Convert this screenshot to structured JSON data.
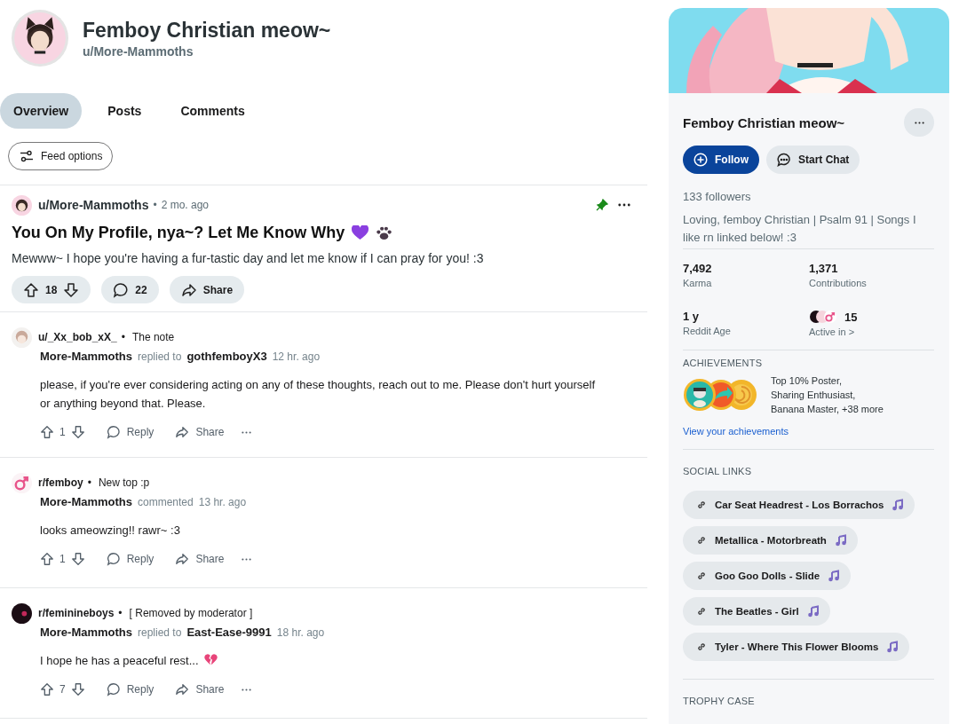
{
  "profile": {
    "display_name": "Femboy Christian meow~",
    "username": "u/More-Mammoths"
  },
  "tabs": [
    {
      "label": "Overview",
      "selected": true
    },
    {
      "label": "Posts",
      "selected": false
    },
    {
      "label": "Comments",
      "selected": false
    }
  ],
  "feed_options": {
    "label": "Feed options"
  },
  "post": {
    "author": "u/More-Mammoths",
    "separator": "•",
    "time": "2 mo. ago",
    "pinned": true,
    "title": "You On My Profile, nya~? Let Me Know Why",
    "title_icons": [
      {
        "kind": "heart"
      },
      {
        "kind": "paw"
      }
    ],
    "body": "Mewww~ I hope you're having a fur-tastic day and let me know if I can pray for you! :3",
    "votes": "18",
    "comments": "22",
    "share": "Share"
  },
  "comments": [
    {
      "source": "u/_Xx_bob_xX_",
      "separator": "•",
      "context": "The note",
      "author": "More-Mammoths",
      "action": "replied to",
      "target": "gothfemboyX3",
      "time": "12 hr. ago",
      "body": "please, if you're ever considering acting on any of these thoughts, reach out to me. Please don't hurt yourself or anything beyond that. Please.",
      "votes": "1",
      "reply": "Reply",
      "share": "Share"
    },
    {
      "avatar": {
        "kind": "male_sign"
      },
      "source": "r/femboy",
      "separator": "•",
      "context": "New top :p",
      "author": "More-Mammoths",
      "action": "commented",
      "time": "13 hr. ago",
      "body": "looks ameowzing!! rawr~ :3",
      "votes": "1",
      "reply": "Reply",
      "share": "Share"
    },
    {
      "avatar": {
        "kind": "dark"
      },
      "source": "r/feminineboys",
      "separator": "•",
      "context": "[ Removed by moderator ]",
      "author": "More-Mammoths",
      "action": "replied to",
      "target": "East-Ease-9991",
      "time": "18 hr. ago",
      "body": "I hope he has a peaceful rest...",
      "trailing_icon": {
        "kind": "broken_heart"
      },
      "votes": "7",
      "reply": "Reply",
      "share": "Share"
    }
  ],
  "sidebar": {
    "name": "Femboy Christian meow~",
    "follow": "Follow",
    "start_chat": "Start Chat",
    "followers": "133 followers",
    "bio": "Loving, femboy Christian | Psalm 91 | Songs I like rn linked below! :3",
    "stats": [
      {
        "value": "7,492",
        "label": "Karma"
      },
      {
        "value": "1,371",
        "label": "Contributions"
      },
      {
        "value": "1 y",
        "label": "Reddit Age"
      },
      {
        "value": "15",
        "label": "Active in >",
        "kind": "communities"
      }
    ],
    "achievements": {
      "heading": "ACHIEVEMENTS",
      "lines": [
        "Top 10% Poster,",
        "Sharing Enthusiast,",
        "Banana Master, +38 more"
      ],
      "link": "View your achievements"
    },
    "social_links": {
      "heading": "SOCIAL LINKS",
      "links": [
        "Car Seat Headrest - Los Borrachos",
        "Metallica - Motorbreath",
        "Goo Goo Dolls - Slide",
        "The Beatles - Girl",
        "Tyler - Where This Flower Blooms"
      ]
    },
    "trophy_case": {
      "heading": "TROPHY CASE"
    }
  }
}
